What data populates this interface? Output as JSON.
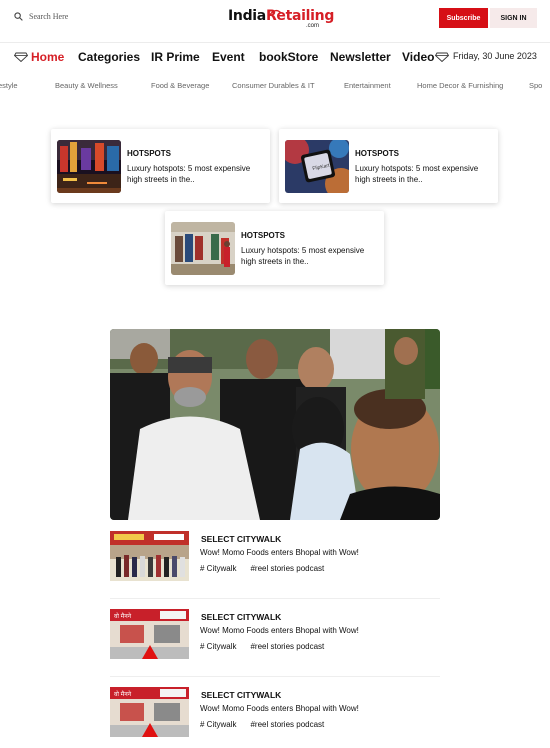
{
  "header": {
    "search_placeholder": "Search Here",
    "logo": {
      "part1": "India",
      "part2": "Retailing",
      "suffix": ".com"
    },
    "subscribe_label": "Subscribe",
    "signin_label": "SIGN IN"
  },
  "nav": {
    "items": [
      {
        "label": "Home",
        "active": true
      },
      {
        "label": "Categories"
      },
      {
        "label": "IR Prime"
      },
      {
        "label": "Event"
      },
      {
        "label": "bookStore"
      },
      {
        "label": "Newsletter"
      },
      {
        "label": "Video"
      }
    ],
    "date": "Friday, 30 June 2023"
  },
  "categories": [
    "estyle",
    "Beauty & Wellness",
    "Food & Beverage",
    "Consumer Durables & IT",
    "Entertainment",
    "Home Decor & Furnishing",
    "Spo"
  ],
  "hotspots": [
    {
      "tag": "HOTSPOTS",
      "title": "Luxury hotspots: 5 most expensive high streets in the.."
    },
    {
      "tag": "HOTSPOTS",
      "title": "Luxury hotspots: 5 most expensive high streets in the.."
    },
    {
      "tag": "HOTSPOTS",
      "title": "Luxury hotspots: 5 most expensive high streets in the.."
    }
  ],
  "stories": [
    {
      "tag": "SELECT CITYWALK",
      "title": "Wow! Momo Foods enters Bhopal with Wow!",
      "tags": [
        "# Citywalk",
        "#reel stories podcast"
      ]
    },
    {
      "tag": "SELECT CITYWALK",
      "title": "Wow! Momo Foods enters Bhopal with Wow!",
      "tags": [
        "# Citywalk",
        "#reel stories podcast"
      ]
    },
    {
      "tag": "SELECT CITYWALK",
      "title": "Wow! Momo Foods enters Bhopal with Wow!",
      "tags": [
        "# Citywalk",
        "#reel stories podcast"
      ]
    }
  ],
  "colors": {
    "accent": "#d61f26",
    "subscribe_bg": "#d60f16",
    "signin_bg": "#f6eaea"
  }
}
